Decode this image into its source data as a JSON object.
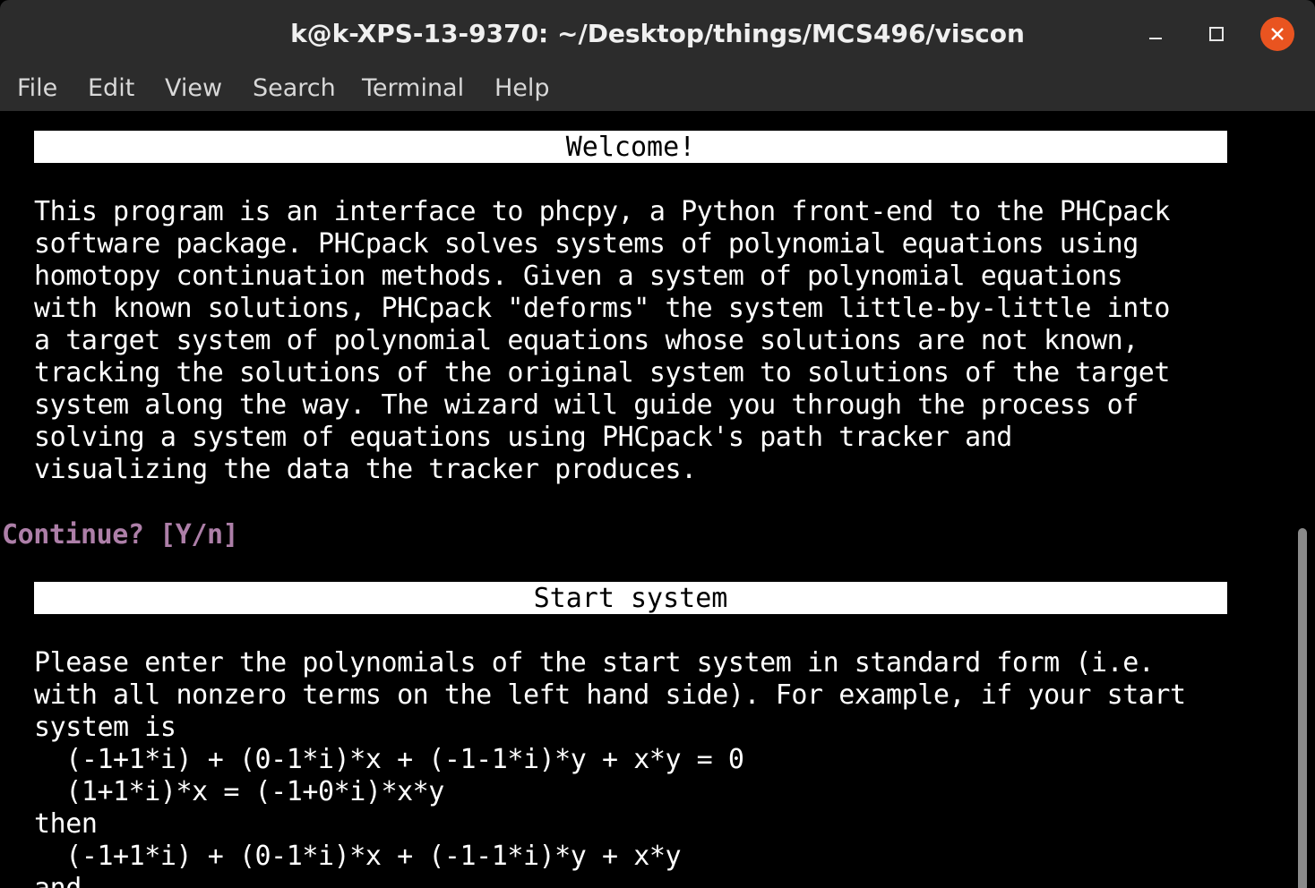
{
  "window": {
    "title": "k@k-XPS-13-9370: ~/Desktop/things/MCS496/viscon",
    "controls": [
      "minimize",
      "maximize",
      "close"
    ],
    "close_color": "#e95420"
  },
  "menu": {
    "items": [
      {
        "label": "File"
      },
      {
        "label": "Edit"
      },
      {
        "label": "View"
      },
      {
        "label": "Search"
      },
      {
        "label": "Terminal"
      },
      {
        "label": "Help"
      }
    ]
  },
  "terminal": {
    "welcome_header": "Welcome!",
    "welcome_text": "This program is an interface to phcpy, a Python front-end to the PHCpack\nsoftware package. PHCpack solves systems of polynomial equations using\nhomotopy continuation methods. Given a system of polynomial equations\nwith known solutions, PHCpack \"deforms\" the system little-by-little into\na target system of polynomial equations whose solutions are not known,\ntracking the solutions of the original system to solutions of the target\nsystem along the way. The wizard will guide you through the process of\nsolving a system of equations using PHCpack's path tracker and\nvisualizing the data the tracker produces.",
    "continue_prompt": "Continue? [Y/n]",
    "start_header": "Start system",
    "start_text": "Please enter the polynomials of the start system in standard form (i.e.\nwith all nonzero terms on the left hand side). For example, if your start\nsystem is\n  (-1+1*i) + (0-1*i)*x + (-1-1*i)*y + x*y = 0\n  (1+1*i)*x = (-1+0*i)*x*y\nthen\n  (-1+1*i) + (0-1*i)*x + (-1-1*i)*y + x*y\nand",
    "prompt_color": "#ad7fa8",
    "background": "#000000",
    "foreground": "#ffffff"
  }
}
